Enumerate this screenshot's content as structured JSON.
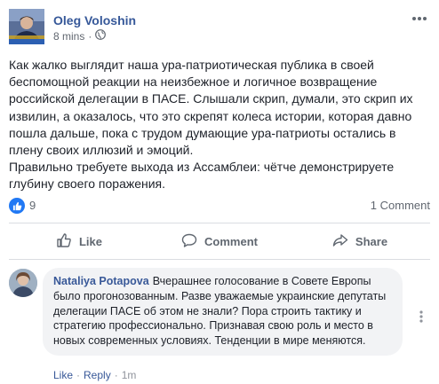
{
  "post": {
    "author": "Oleg Voloshin",
    "time": "8 mins",
    "dot": "·",
    "paragraphs": [
      "Как жалко выглядит наша ура-патриотическая публика в своей беспомощной реакции на неизбежное и логичное возвращение российской делегации в ПАСЕ. Слышали скрип, думали, это скрип их извилин, а оказалось, что это скрепят колеса истории, которая давно пошла дальше, пока с трудом думающие ура-патриоты остались в плену своих иллюзий и эмоций.",
      "Правильно требуете выхода из Ассамблеи: чётче демонстрируете глубину своего поражения."
    ]
  },
  "reactions": {
    "count": "9",
    "comments": "1 Comment"
  },
  "actions": {
    "like": "Like",
    "comment": "Comment",
    "share": "Share"
  },
  "comment": {
    "author": "Nataliya Potapova",
    "text": "Вчерашнее голосование в Совете Европы было прогонозованным. Разве уважаемые украинские депутаты делегации ПАСЕ об этом не знали? Пора строить тактику и стратегию профессионально. Признавая свою роль и место в новых современных условиях. Тенденции в мире меняются.",
    "like": "Like",
    "reply": "Reply",
    "sep": "·",
    "time": "1m"
  },
  "colors": {
    "link": "#365899",
    "like_blue": "#2078f4",
    "muted": "#616770",
    "bubble": "#f2f3f5"
  }
}
